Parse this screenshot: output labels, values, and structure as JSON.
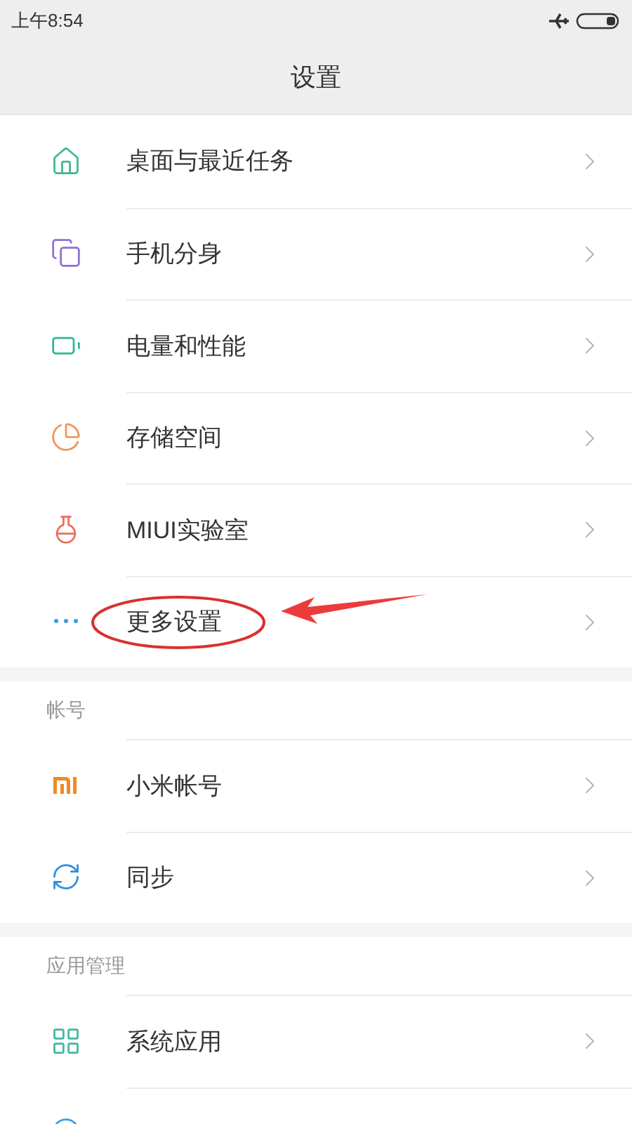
{
  "status_bar": {
    "time": "上午8:54"
  },
  "title": "设置",
  "sections": [
    {
      "items": [
        {
          "label": "桌面与最近任务",
          "highlighted": false
        },
        {
          "label": "手机分身",
          "highlighted": false
        },
        {
          "label": "电量和性能",
          "highlighted": false
        },
        {
          "label": "存储空间",
          "highlighted": false
        },
        {
          "label": "MIUI实验室",
          "highlighted": false
        },
        {
          "label": "更多设置",
          "highlighted": true
        }
      ]
    },
    {
      "header": "帐号",
      "items": [
        {
          "label": "小米帐号",
          "highlighted": false
        },
        {
          "label": "同步",
          "highlighted": false
        }
      ]
    },
    {
      "header": "应用管理",
      "items": [
        {
          "label": "系统应用",
          "highlighted": false
        },
        {
          "highlighted": false
        }
      ]
    }
  ]
}
